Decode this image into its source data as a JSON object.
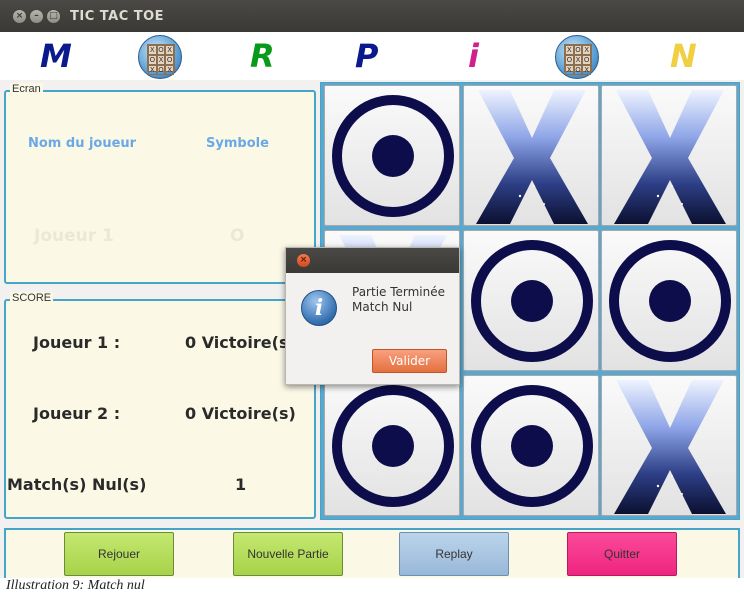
{
  "window": {
    "title": "TIC TAC TOE"
  },
  "banner": {
    "letters": [
      {
        "text": "M",
        "color": "#0a1a8c"
      },
      {
        "text": "R",
        "color": "#0a9a1a"
      },
      {
        "text": "P",
        "color": "#0a1a8c"
      },
      {
        "text": "i",
        "color": "#d0208a"
      },
      {
        "text": "N",
        "color": "#f0d040"
      }
    ],
    "logo_marks": [
      "X",
      "O",
      "X",
      "O",
      "X",
      "O",
      "X",
      "O",
      "X"
    ]
  },
  "ecran": {
    "legend": "Ecran",
    "col_player": "Nom du joueur",
    "col_symbol": "Symbole",
    "player_name": "Joueur 1",
    "player_symbol": "O"
  },
  "score": {
    "legend": "SCORE",
    "p1_label": "Joueur 1 :",
    "p1_value": "0 Victoire(s",
    "p2_label": "Joueur 2 :",
    "p2_value": "0 Victoire(s)",
    "draw_label": "Match(s) Nul(s)",
    "draw_value": "1"
  },
  "board": [
    "O",
    "X",
    "X",
    "X",
    "O",
    "O",
    "O",
    "O",
    "X"
  ],
  "buttons": {
    "rejouer": "Rejouer",
    "nouvelle": "Nouvelle Partie",
    "replay": "Replay",
    "quitter": "Quitter"
  },
  "dialog": {
    "line1": "Partie Terminée",
    "line2": "Match Nul",
    "ok": "Valider",
    "icon_glyph": "i"
  },
  "caption": "Illustration 9: Match nul",
  "colors": {
    "accent_border": "#45a5c9",
    "o_ring": "#0c0d4a",
    "btn_green": "#b5df5a",
    "btn_blue": "#a5c3df",
    "btn_pink": "#f5318a"
  }
}
